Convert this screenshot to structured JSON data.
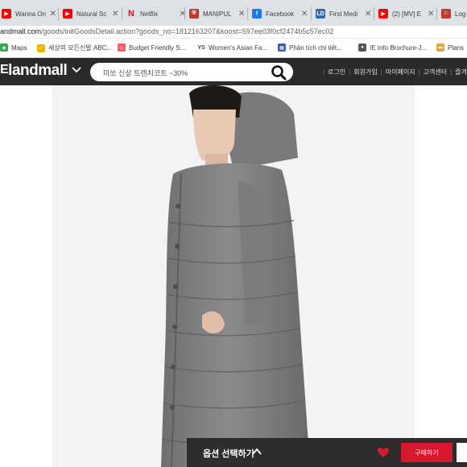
{
  "browser": {
    "tabs": [
      {
        "title": "Wanna On",
        "icon": "youtube-icon",
        "color": "#ff0000"
      },
      {
        "title": "Natural Sc",
        "icon": "youtube-icon",
        "color": "#ff0000"
      },
      {
        "title": "Netflix",
        "icon": "netflix-icon",
        "color": "#e50914"
      },
      {
        "title": "MANIPUL",
        "icon": "shield-icon",
        "color": "#c0392b"
      },
      {
        "title": "Facebook",
        "icon": "facebook-icon",
        "color": "#1877f2"
      },
      {
        "title": "First Medi",
        "icon": "ld-icon",
        "color": "#2a6eb5"
      },
      {
        "title": "(2) [MV] E",
        "icon": "youtube-icon",
        "color": "#ff0000"
      },
      {
        "title": "Log",
        "icon": "log-icon",
        "color": "#c0392b"
      }
    ],
    "address": {
      "host": "andmall.com",
      "path": "/goods/initGoodsDetail.action?goods_no=1812163207&koost=597ee03f0cf2474b5c57ec02"
    },
    "bookmarks": [
      {
        "label": "Maps",
        "icon": "maps-icon",
        "color": "#34a853"
      },
      {
        "label": "세상의 모든신발 ABC...",
        "icon": "abc-icon",
        "color": "#f4b400"
      },
      {
        "label": "Budget Friendly S...",
        "icon": "airbnb-icon",
        "color": "#ff5a5f"
      },
      {
        "label": "Women's Asian Fa...",
        "icon": "ys-icon",
        "color": "#444444"
      },
      {
        "label": "Phân tích chi tiết...",
        "icon": "grid-icon",
        "color": "#3a5fa0"
      },
      {
        "label": "IE Info Brochure-J...",
        "icon": "location-icon",
        "color": "#555555"
      },
      {
        "label": "Plans",
        "icon": "plans-icon",
        "color": "#e8a33d"
      }
    ]
  },
  "site": {
    "logo": "landmall",
    "search_placeholder": "미쏘 신상 트렌치코트 ~30%",
    "links": [
      "로그인",
      "회원가입",
      "마이페이지",
      "고객센터",
      "즐겨"
    ]
  },
  "purchase_bar": {
    "option_label": "옵션 선택하기",
    "buy_label": "구매하기",
    "accent": "#d9182d"
  }
}
